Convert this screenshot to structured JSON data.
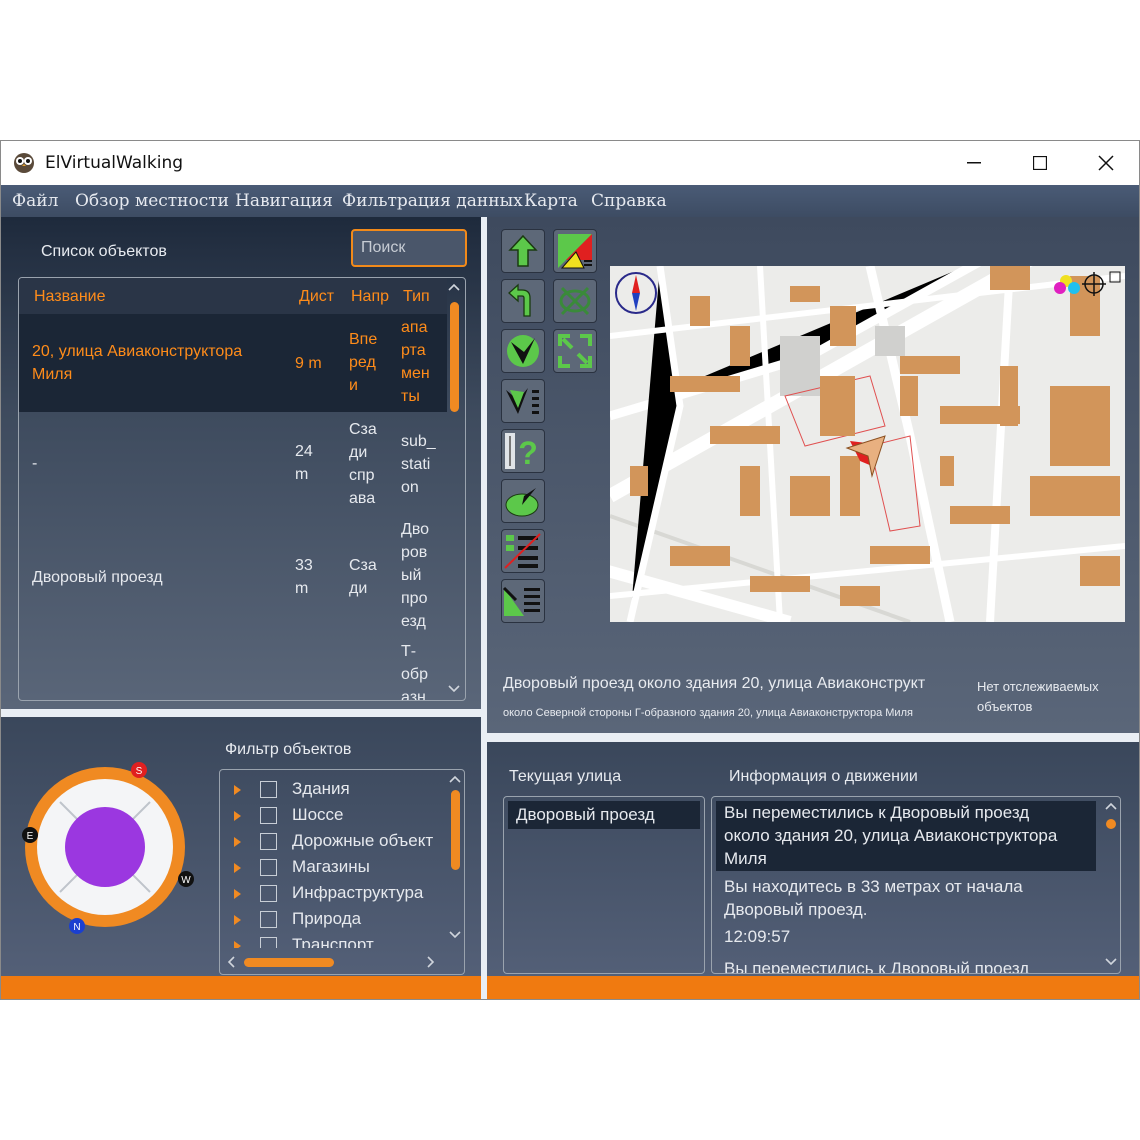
{
  "app": {
    "title": "ElVirtualWalking"
  },
  "window_controls": {
    "minimize": "—",
    "maximize": "☐",
    "close": "✕"
  },
  "menu": [
    "Файл",
    "Обзор местности",
    "Навигация",
    "Фильтрация данных",
    "Карта",
    "Справка"
  ],
  "objects_panel": {
    "title": "Список объектов",
    "search_placeholder": "Поиск",
    "columns": [
      "Название",
      "Дист",
      "Напр",
      "Тип"
    ],
    "rows": [
      {
        "name": [
          "20, улица Авиаконструктора",
          "Миля"
        ],
        "dist": [
          "9 m"
        ],
        "dir": [
          "Впе",
          "ред",
          "и"
        ],
        "type": [
          "апа",
          "рта",
          "мен",
          "ты"
        ],
        "selected": true
      },
      {
        "name": [
          "-"
        ],
        "dist": [
          "24",
          "m"
        ],
        "dir": [
          "Сза",
          "ди",
          "спр",
          "ава"
        ],
        "type": [
          "sub_",
          "stati",
          "on"
        ],
        "selected": false
      },
      {
        "name": [
          "Дворовый проезд"
        ],
        "dist": [
          "33",
          "m"
        ],
        "dir": [
          "Сза",
          "ди"
        ],
        "type": [
          "Дво",
          "ров",
          "ый",
          "про",
          "езд"
        ],
        "selected": false
      },
      {
        "name": [
          ""
        ],
        "dist": [
          ""
        ],
        "dir": [
          ""
        ],
        "type": [
          "Т-",
          "обр",
          "азн"
        ],
        "selected": false
      }
    ]
  },
  "compass": {
    "labels": {
      "s": "S",
      "e": "E",
      "w": "W",
      "n": "N"
    },
    "accent": "#f08a22",
    "center": "#9b37e0"
  },
  "filter_panel": {
    "title": "Фильтр объектов",
    "items": [
      "Здания",
      "Шоссе",
      "Дорожные объект",
      "Магазины",
      "Инфраструктура",
      "Природа",
      "Транспорт"
    ]
  },
  "toolbar": {
    "icons": [
      "arrow-up-icon",
      "map-layers-icon",
      "turn-back-icon",
      "target-off-icon",
      "check-v-icon",
      "fullscreen-icon",
      "check-list-icon",
      "help-road-icon",
      "radar-icon",
      "list-off-icon",
      "road-list-icon"
    ]
  },
  "map_status": {
    "main": "Дворовый проезд около здания 20, улица Авиаконструкт",
    "sub": "около Северной стороны Г-образного здания 20, улица Авиаконструктора Миля",
    "tracking": [
      "Нет отслеживаемых",
      "объектов"
    ]
  },
  "street_panel": {
    "title": "Текущая улица",
    "value": "Дворовый проезд"
  },
  "movement_panel": {
    "title": "Информация о движении",
    "messages": [
      [
        "Вы переместились к Дворовый проезд",
        "около здания 20, улица Авиаконструктора",
        "Миля"
      ],
      [
        "Вы находитесь в 33 метрах  от начала",
        "Дворовый проезд."
      ],
      [
        "12:09:57"
      ],
      [
        "Вы переместились к Дворовый проезд"
      ]
    ]
  },
  "colors": {
    "accent": "#f08a22",
    "menu_bg": "#3d4c63",
    "panel_dark": "#1e2a3c"
  }
}
